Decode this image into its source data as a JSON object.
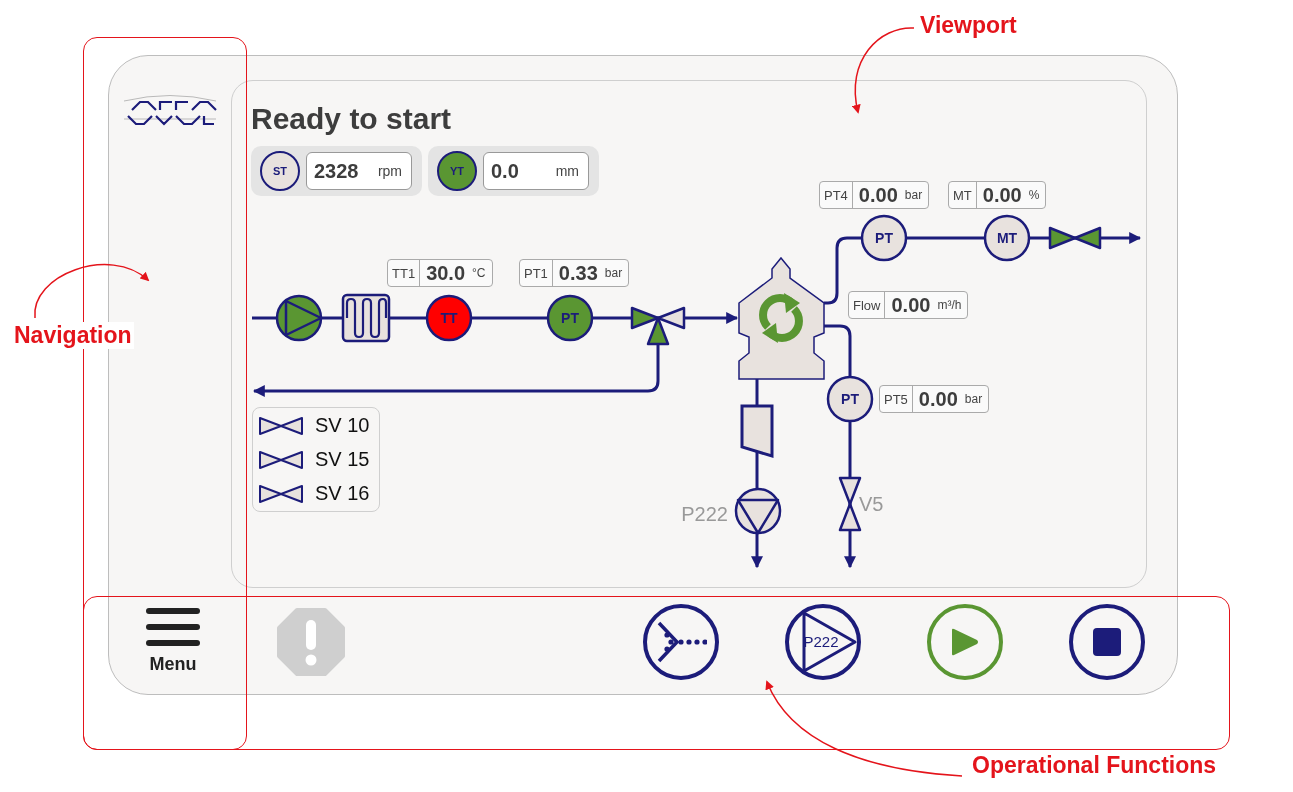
{
  "annotations": [
    {
      "label": "Viewport"
    },
    {
      "label": "Navigation"
    },
    {
      "label": "Operational Functions"
    }
  ],
  "status_title": "Ready to start",
  "speed_chips": [
    {
      "tag": "ST",
      "value": "2328",
      "unit": "rpm",
      "color": "#e8e2de"
    },
    {
      "tag": "YT",
      "value": "0.0",
      "unit": "mm",
      "color": "#5a9632"
    }
  ],
  "readouts": [
    {
      "tag": "PT4",
      "value": "0.00",
      "unit": "bar"
    },
    {
      "tag": "MT",
      "value": "0.00",
      "unit": "%"
    },
    {
      "tag": "TT1",
      "value": "30.0",
      "unit": "°C"
    },
    {
      "tag": "PT1",
      "value": "0.33",
      "unit": "bar"
    },
    {
      "tag": "Flow",
      "value": "0.00",
      "unit": "m³/h"
    },
    {
      "tag": "PT5",
      "value": "0.00",
      "unit": "bar"
    }
  ],
  "instruments": [
    {
      "tag": "PT",
      "color": "#e8e2de"
    },
    {
      "tag": "MT",
      "color": "#e8e2de"
    },
    {
      "tag": "TT",
      "color": "#ff0000"
    },
    {
      "tag": "PT",
      "color": "#5a9632"
    },
    {
      "tag": "PT",
      "color": "#e8e2de"
    }
  ],
  "feed_pump": {
    "running": true
  },
  "separator": {
    "running": true
  },
  "three_way_valve": {
    "open": true
  },
  "outlet_valve": {
    "open": true
  },
  "drain_pump": {
    "label": "P222",
    "running": false
  },
  "drain_valve": {
    "label": "V5",
    "open": false
  },
  "seat_valves": [
    {
      "label": "SV 10",
      "open": false
    },
    {
      "label": "SV 15",
      "open": false
    },
    {
      "label": "SV 16",
      "open": false
    }
  ],
  "bottom_bar": {
    "menu": {
      "label": "Menu"
    },
    "alarm": {
      "active": false
    },
    "actions": [
      {
        "kind": "sequence"
      },
      {
        "kind": "pump",
        "label": "P222"
      },
      {
        "kind": "start"
      },
      {
        "kind": "stop"
      }
    ]
  }
}
